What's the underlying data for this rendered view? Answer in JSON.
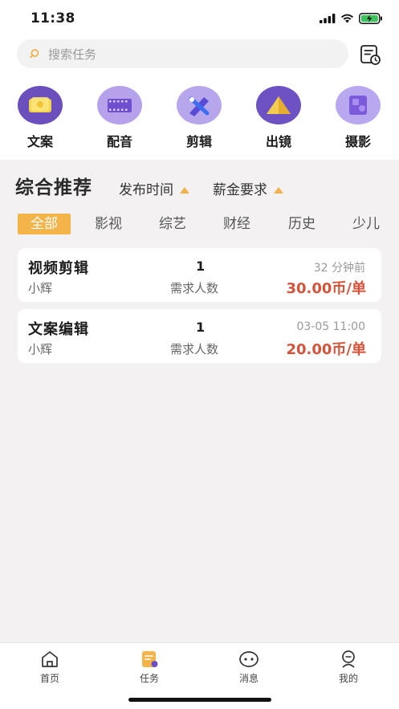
{
  "status_bar": {
    "time": "11:38"
  },
  "search": {
    "placeholder": "搜索任务"
  },
  "categories": [
    {
      "label": "文案",
      "icon": "copywriting-icon"
    },
    {
      "label": "配音",
      "icon": "dubbing-icon"
    },
    {
      "label": "剪辑",
      "icon": "editing-icon"
    },
    {
      "label": "出镜",
      "icon": "on-camera-icon"
    },
    {
      "label": "摄影",
      "icon": "photography-icon"
    }
  ],
  "section": {
    "title": "综合推荐",
    "sort_publish_time": "发布时间",
    "sort_salary": "薪金要求"
  },
  "filter_tabs": [
    "全部",
    "影视",
    "综艺",
    "财经",
    "历史",
    "少儿"
  ],
  "filter_tabs_active": "全部",
  "tasks": [
    {
      "title": "视频剪辑",
      "user": "小辉",
      "count": "1",
      "count_label": "需求人数",
      "time": "32 分钟前",
      "price": "30.00币/单"
    },
    {
      "title": "文案编辑",
      "user": "小辉",
      "count": "1",
      "count_label": "需求人数",
      "time": "03-05 11:00",
      "price": "20.00币/单"
    }
  ],
  "bottom_nav": [
    {
      "label": "首页",
      "icon": "home-icon"
    },
    {
      "label": "任务",
      "icon": "task-icon"
    },
    {
      "label": "消息",
      "icon": "message-icon"
    },
    {
      "label": "我的",
      "icon": "profile-icon"
    }
  ],
  "bottom_nav_active": "任务",
  "colors": {
    "accent": "#f3b54a",
    "price": "#d3533b",
    "background": "#f3f1f2",
    "category_purple": "#6b4fc6"
  }
}
